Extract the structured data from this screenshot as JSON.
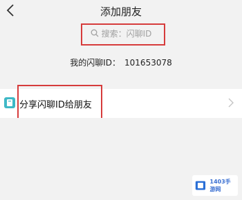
{
  "header": {
    "title": "添加朋友",
    "back_icon": "chevron-left-icon"
  },
  "search": {
    "placeholder": "搜索：闪聊ID",
    "icon": "search-icon"
  },
  "account": {
    "label": "我的闪聊ID：",
    "id": "101653078"
  },
  "share": {
    "label": "分享闪聊ID给朋友",
    "icon": "share-app-icon",
    "chevron": "chevron-right-icon"
  },
  "watermark": {
    "text": "1403手游网"
  },
  "colors": {
    "background": "#f2f2f2",
    "annotation_red": "#d63b3b",
    "accent_teal": "#3fb8c6"
  }
}
